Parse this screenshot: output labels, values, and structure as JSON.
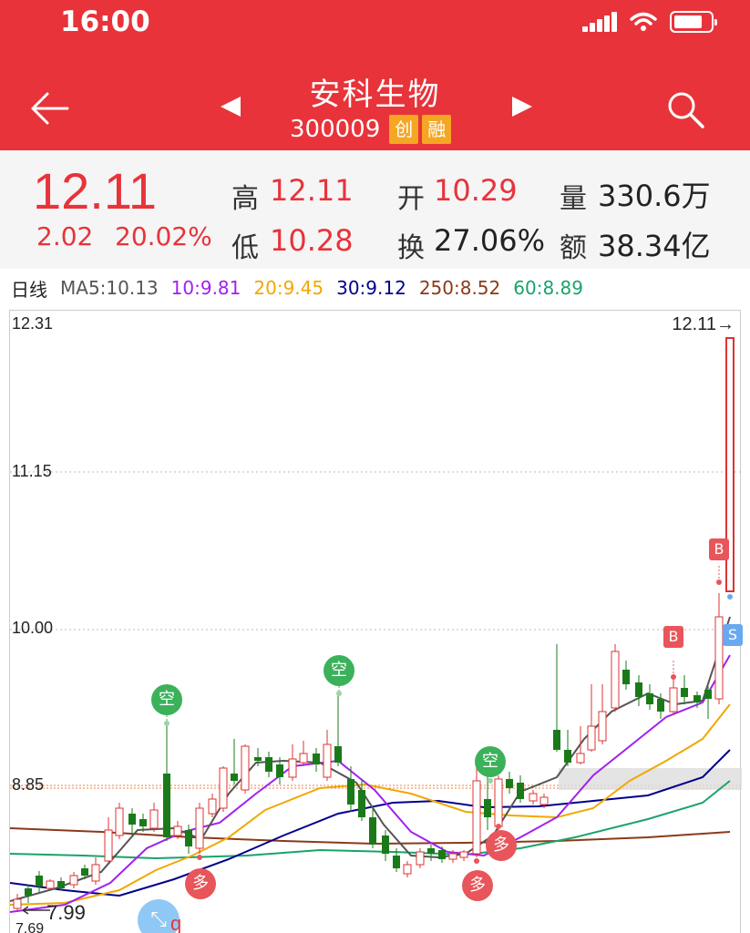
{
  "status": {
    "time": "16:00"
  },
  "header": {
    "name": "安科生物",
    "code": "300009",
    "tag1": "创",
    "tag2": "融"
  },
  "quote": {
    "price": "12.11",
    "change": "2.02",
    "change_pct": "20.02%",
    "high_label": "高",
    "high": "12.11",
    "open_label": "开",
    "open": "10.29",
    "vol_label": "量",
    "vol": "330.6万",
    "low_label": "低",
    "low": "10.28",
    "turnover_label": "换",
    "turnover": "27.06%",
    "amount_label": "额",
    "amount": "38.34亿"
  },
  "ma": {
    "period": "日线",
    "ma5": "MA5:10.13",
    "ma10": "10:9.81",
    "ma20": "20:9.45",
    "ma30": "30:9.12",
    "ma250": "250:8.52",
    "ma60": "60:8.89",
    "colors": {
      "ma5": "#555555",
      "ma10": "#a020f0",
      "ma20": "#f0a800",
      "ma30": "#00008b",
      "ma250": "#8b3a1a",
      "ma60": "#1aa36b"
    }
  },
  "chart": {
    "y_top": "12.31",
    "y_mid1": "11.15",
    "y_mid2": "10.00",
    "y_mid3": "8.85",
    "last_price": "12.11→",
    "low_marker": "7.99",
    "bottom_label": "7.69",
    "marker_kong": "空",
    "marker_duo": "多",
    "marker_b": "B",
    "marker_s": "S",
    "marker_q": "q"
  }
}
